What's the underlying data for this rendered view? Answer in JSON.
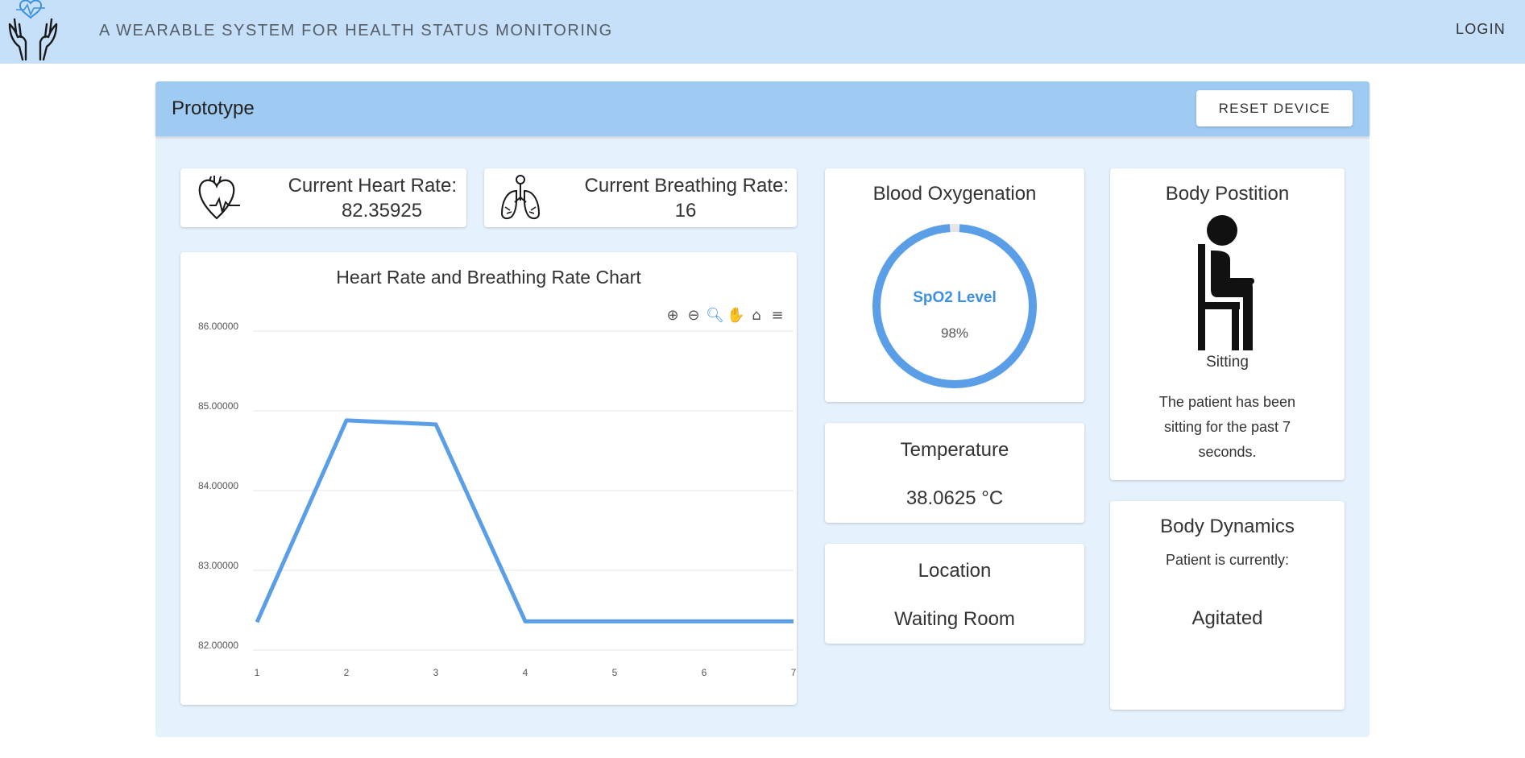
{
  "header": {
    "title": "A WEARABLE SYSTEM FOR HEALTH STATUS MONITORING",
    "login_label": "LOGIN",
    "logo_icon": "hands-heart-icon"
  },
  "panel": {
    "title": "Prototype",
    "reset_label": "RESET DEVICE"
  },
  "heart_rate": {
    "label": "Current Heart Rate:",
    "value": "82.35925",
    "icon": "heart-pulse-icon"
  },
  "breathing_rate": {
    "label": "Current Breathing Rate:",
    "value": "16",
    "icon": "lungs-icon"
  },
  "chart": {
    "toolbar": [
      "zoom-in-icon",
      "zoom-out-icon",
      "selection-zoom-icon",
      "pan-icon",
      "home-reset-icon",
      "menu-icon"
    ]
  },
  "chart_data": {
    "type": "line",
    "title": "Heart Rate and Breathing Rate Chart",
    "xlabel": "",
    "ylabel": "",
    "x": [
      1,
      2,
      3,
      4,
      5,
      6,
      7
    ],
    "series": [
      {
        "values": [
          82.35,
          84.88,
          84.83,
          82.36,
          82.36,
          82.36,
          82.36
        ]
      }
    ],
    "y_tick_labels": [
      "82.00000",
      "83.00000",
      "84.00000",
      "85.00000",
      "86.00000"
    ],
    "x_tick_labels": [
      "1",
      "2",
      "3",
      "4",
      "5",
      "6",
      "7"
    ],
    "ylim": [
      82,
      86
    ],
    "xlim": [
      1,
      7
    ],
    "grid": true,
    "color": "#5a9ee8"
  },
  "oxygen": {
    "title": "Blood Oxygenation",
    "gauge_label": "SpO2 Level",
    "value_text": "98%",
    "level": 0.98,
    "ring_color": "#5a9ee8",
    "label_color": "#3d8fe0"
  },
  "temperature": {
    "title": "Temperature",
    "value": "38.0625 °C"
  },
  "location": {
    "title": "Location",
    "value": "Waiting Room"
  },
  "body_position": {
    "title": "Body Postition",
    "icon": "person-sitting-icon",
    "state": "Sitting",
    "description": [
      "The patient has been",
      "sitting for the past 7",
      "seconds."
    ]
  },
  "body_dynamics": {
    "title": "Body Dynamics",
    "subtitle": "Patient is currently:",
    "state": "Agitated"
  }
}
